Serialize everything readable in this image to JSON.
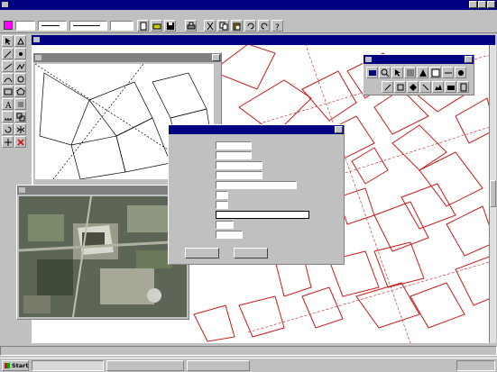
{
  "app": {
    "title": ""
  },
  "menu": [
    "",
    "",
    "",
    "",
    "",
    "",
    "",
    "",
    "",
    ""
  ],
  "toolbar": {
    "level_value": "",
    "page_text": ""
  },
  "windows": {
    "w1": {
      "title": ""
    },
    "w2": {
      "title": "",
      "labels": [
        "",
        "",
        "",
        "",
        "",
        "",
        "",
        "",
        "",
        ""
      ]
    },
    "w3": {
      "title": ""
    }
  },
  "info_panel": {
    "title": ""
  },
  "map_labels": [
    "",
    "",
    "",
    "",
    "",
    "",
    "",
    "",
    "",
    "",
    "",
    "",
    "",
    ""
  ],
  "dialog": {
    "title": "",
    "fields": [
      {
        "label": "",
        "value": ""
      },
      {
        "label": "",
        "value": ""
      },
      {
        "label": "",
        "value": ""
      },
      {
        "label": "",
        "value": ""
      },
      {
        "label": "",
        "value": ""
      },
      {
        "label": "",
        "value": ""
      },
      {
        "label": "",
        "value": ""
      },
      {
        "label": "",
        "value": ""
      },
      {
        "label": "",
        "value": ""
      },
      {
        "label": "",
        "value": ""
      }
    ],
    "buttons": {
      "ok": "",
      "close": ""
    }
  },
  "statusbar": {
    "text": ""
  },
  "taskbar": {
    "start": "Start",
    "tasks": [
      "",
      "",
      ""
    ],
    "clock": ""
  },
  "colors": {
    "titlebar": "#000080",
    "parcel_outline": "#cc1a1a",
    "map_bg": "#ffffff",
    "desktop": "#008080"
  }
}
